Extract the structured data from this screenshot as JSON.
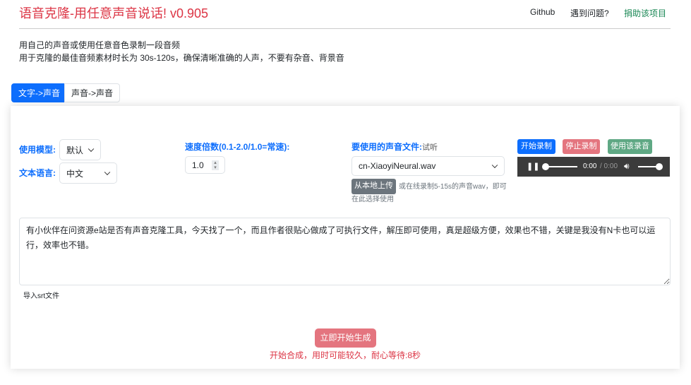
{
  "header": {
    "title": "语音克隆-用任意声音说话! v0.905",
    "nav": [
      "Github",
      "遇到问题?",
      "捐助该项目"
    ]
  },
  "intro": {
    "line1": "用自己的声音或使用任意音色录制一段音频",
    "line2": "用于克隆的最佳音频素材时长为 30s-120s，确保清晰准确的人声，不要有杂音、背景音"
  },
  "tabs": [
    "文字->声音",
    "声音->声音"
  ],
  "form": {
    "model_label": "使用模型:",
    "model_value": "默认",
    "lang_label": "文本语言:",
    "lang_value": "中文",
    "speed_label": "速度倍数(0.1-2.0/1.0=常速):",
    "speed_value": "1.0",
    "voice_label": "要使用的声音文件:",
    "voice_preview": "试听",
    "voice_value": "cn-XiaoyiNeural.wav",
    "upload_label": "从本地上传",
    "upload_hint": "或在线录制5-15s的声音wav，即可在此选择使用",
    "record_start": "开始录制",
    "record_stop": "停止录制",
    "record_use": "使用该录音",
    "audio_time": "0:00",
    "audio_duration": "/ 0:00",
    "text": "有小伙伴在问资源e站是否有声音克隆工具，今天找了一个，而且作者很贴心做成了可执行文件，解压即可使用，真是超级方便，效果也不错，关键是我没有N卡也可以运行，效率也不错。",
    "srt_label": "导入srt文件",
    "generate_label": "立即开始生成",
    "status": "开始合成，用时可能较久，耐心等待:8秒"
  },
  "colors": {
    "primary": "#0d6efd",
    "danger": "#dc3545",
    "success": "#198754"
  }
}
